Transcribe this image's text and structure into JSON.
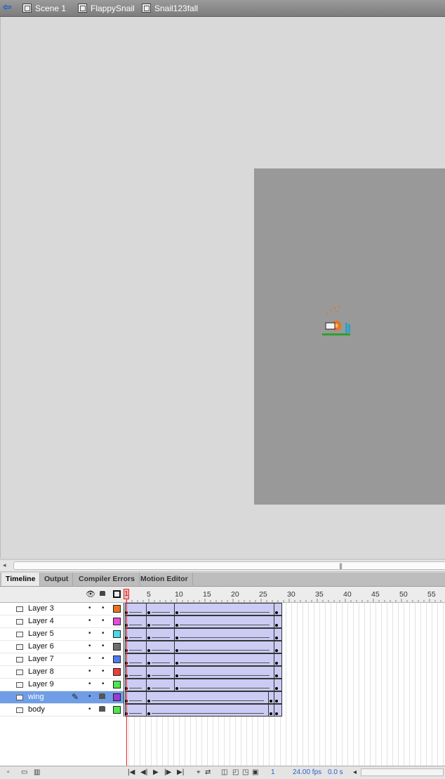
{
  "breadcrumbs": [
    {
      "label": "Scene 1",
      "icon": "clapper-icon"
    },
    {
      "label": "FlappySnail",
      "icon": "movieclip-icon"
    },
    {
      "label": "Snail123fall",
      "icon": "movieclip-icon"
    }
  ],
  "tabs": [
    "Timeline",
    "Output",
    "Compiler Errors",
    "Motion Editor"
  ],
  "ruler": {
    "current": "1",
    "marks": [
      "5",
      "10",
      "15",
      "20",
      "25",
      "30",
      "35",
      "40",
      "45",
      "50",
      "55"
    ]
  },
  "header_icons": [
    "eye-icon",
    "lock-icon",
    "outline-icon"
  ],
  "layers": [
    {
      "name": "Layer 3",
      "color": "#e8731d",
      "locked": false
    },
    {
      "name": "Layer 4",
      "color": "#e54cdc",
      "locked": false
    },
    {
      "name": "Layer 5",
      "color": "#47dbe8",
      "locked": false
    },
    {
      "name": "Layer 6",
      "color": "#6e6e6e",
      "locked": false
    },
    {
      "name": "Layer 7",
      "color": "#4d7cf0",
      "locked": false
    },
    {
      "name": "Layer 8",
      "color": "#ec3c3c",
      "locked": false
    },
    {
      "name": "Layer 9",
      "color": "#4ce84c",
      "locked": false
    },
    {
      "name": "wing",
      "color": "#9b3ad6",
      "locked": true,
      "selected": true
    },
    {
      "name": "body",
      "color": "#4ce84c",
      "locked": true
    }
  ],
  "footer": {
    "frame": "1",
    "fps": "24.00 fps",
    "time": "0.0 s"
  },
  "stage": {
    "background": "#999999",
    "pasteboard": "#d9d9d9"
  }
}
